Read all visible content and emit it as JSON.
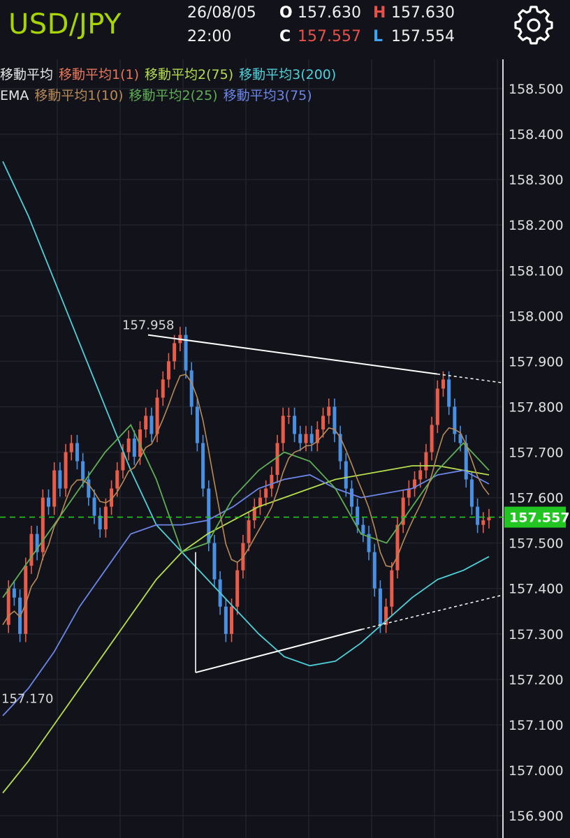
{
  "header": {
    "pair": "USD/JPY",
    "date": "26/08/05",
    "time": "22:00",
    "open_label": "O",
    "open": "157.630",
    "high_label": "H",
    "high": "157.630",
    "close_label": "C",
    "close": "157.557",
    "low_label": "L",
    "low": "157.554"
  },
  "legend_sma": {
    "title": "移動平均",
    "ma1": "移動平均1(1)",
    "ma2": "移動平均2(75)",
    "ma3": "移動平均3(200)"
  },
  "legend_ema": {
    "title": "EMA",
    "ma1": "移動平均1(10)",
    "ma2": "移動平均2(25)",
    "ma3": "移動平均3(75)"
  },
  "colors": {
    "accent": "#a8d400",
    "bull": "#e85c4a",
    "bear": "#4a90e2",
    "sma1": "#e8775a",
    "sma2": "#b6dd4c",
    "sma3": "#4fd0d8",
    "ema1": "#b98a58",
    "ema2": "#5fae55",
    "ema3": "#6c86e8",
    "price_line": "#22c522",
    "trendline": "#ffffff"
  },
  "chart_data": {
    "type": "line",
    "title": "USD/JPY",
    "ylim": [
      156.88,
      158.56
    ],
    "y_ticks": [
      "158.500",
      "158.400",
      "158.300",
      "158.200",
      "158.100",
      "158.000",
      "157.900",
      "157.800",
      "157.700",
      "157.600",
      "157.500",
      "157.400",
      "157.300",
      "157.200",
      "157.100",
      "157.000",
      "156.900"
    ],
    "grid": true,
    "current_price": "157.557",
    "annotations": [
      {
        "text": "157.958",
        "value": 157.958
      },
      {
        "text": "157.170",
        "value": 157.17
      }
    ],
    "price_series": [
      157.32,
      157.4,
      157.38,
      157.3,
      157.45,
      157.52,
      157.48,
      157.6,
      157.58,
      157.66,
      157.62,
      157.7,
      157.72,
      157.68,
      157.64,
      157.6,
      157.56,
      157.53,
      157.58,
      157.62,
      157.66,
      157.7,
      157.73,
      157.69,
      157.75,
      157.78,
      157.74,
      157.82,
      157.86,
      157.9,
      157.94,
      157.958,
      157.88,
      157.8,
      157.72,
      157.62,
      157.5,
      157.42,
      157.36,
      157.3,
      157.36,
      157.44,
      157.5,
      157.55,
      157.58,
      157.6,
      157.62,
      157.65,
      157.72,
      157.78,
      157.78,
      157.74,
      157.72,
      157.74,
      157.72,
      157.75,
      157.78,
      157.8,
      157.74,
      157.68,
      157.62,
      157.58,
      157.54,
      157.52,
      157.48,
      157.4,
      157.32,
      157.36,
      157.44,
      157.54,
      157.6,
      157.62,
      157.64,
      157.66,
      157.7,
      157.76,
      157.84,
      157.86,
      157.8,
      157.74,
      157.72,
      157.64,
      157.58,
      157.54,
      157.55,
      157.557
    ],
    "series": [
      {
        "name": "移動平均2(75)",
        "values": [
          156.95,
          157.02,
          157.1,
          157.18,
          157.26,
          157.34,
          157.42,
          157.48,
          157.52,
          157.55,
          157.58,
          157.6,
          157.62,
          157.64,
          157.65,
          157.66,
          157.67,
          157.67,
          157.66,
          157.65
        ]
      },
      {
        "name": "移動平均3(200)",
        "values": [
          158.34,
          158.22,
          158.08,
          157.94,
          157.8,
          157.66,
          157.54,
          157.48,
          157.42,
          157.36,
          157.3,
          157.25,
          157.23,
          157.24,
          157.28,
          157.33,
          157.38,
          157.42,
          157.44,
          157.47
        ]
      },
      {
        "name": "移動平均3(75)",
        "values": [
          157.12,
          157.18,
          157.26,
          157.36,
          157.44,
          157.52,
          157.54,
          157.54,
          157.55,
          157.58,
          157.62,
          157.64,
          157.65,
          157.62,
          157.6,
          157.61,
          157.62,
          157.65,
          157.66,
          157.63
        ]
      },
      {
        "name": "移動平均2(25)",
        "values": [
          157.38,
          157.46,
          157.54,
          157.62,
          157.7,
          157.76,
          157.64,
          157.48,
          157.5,
          157.6,
          157.66,
          157.7,
          157.68,
          157.62,
          157.52,
          157.5,
          157.58,
          157.66,
          157.72,
          157.66
        ]
      }
    ]
  }
}
